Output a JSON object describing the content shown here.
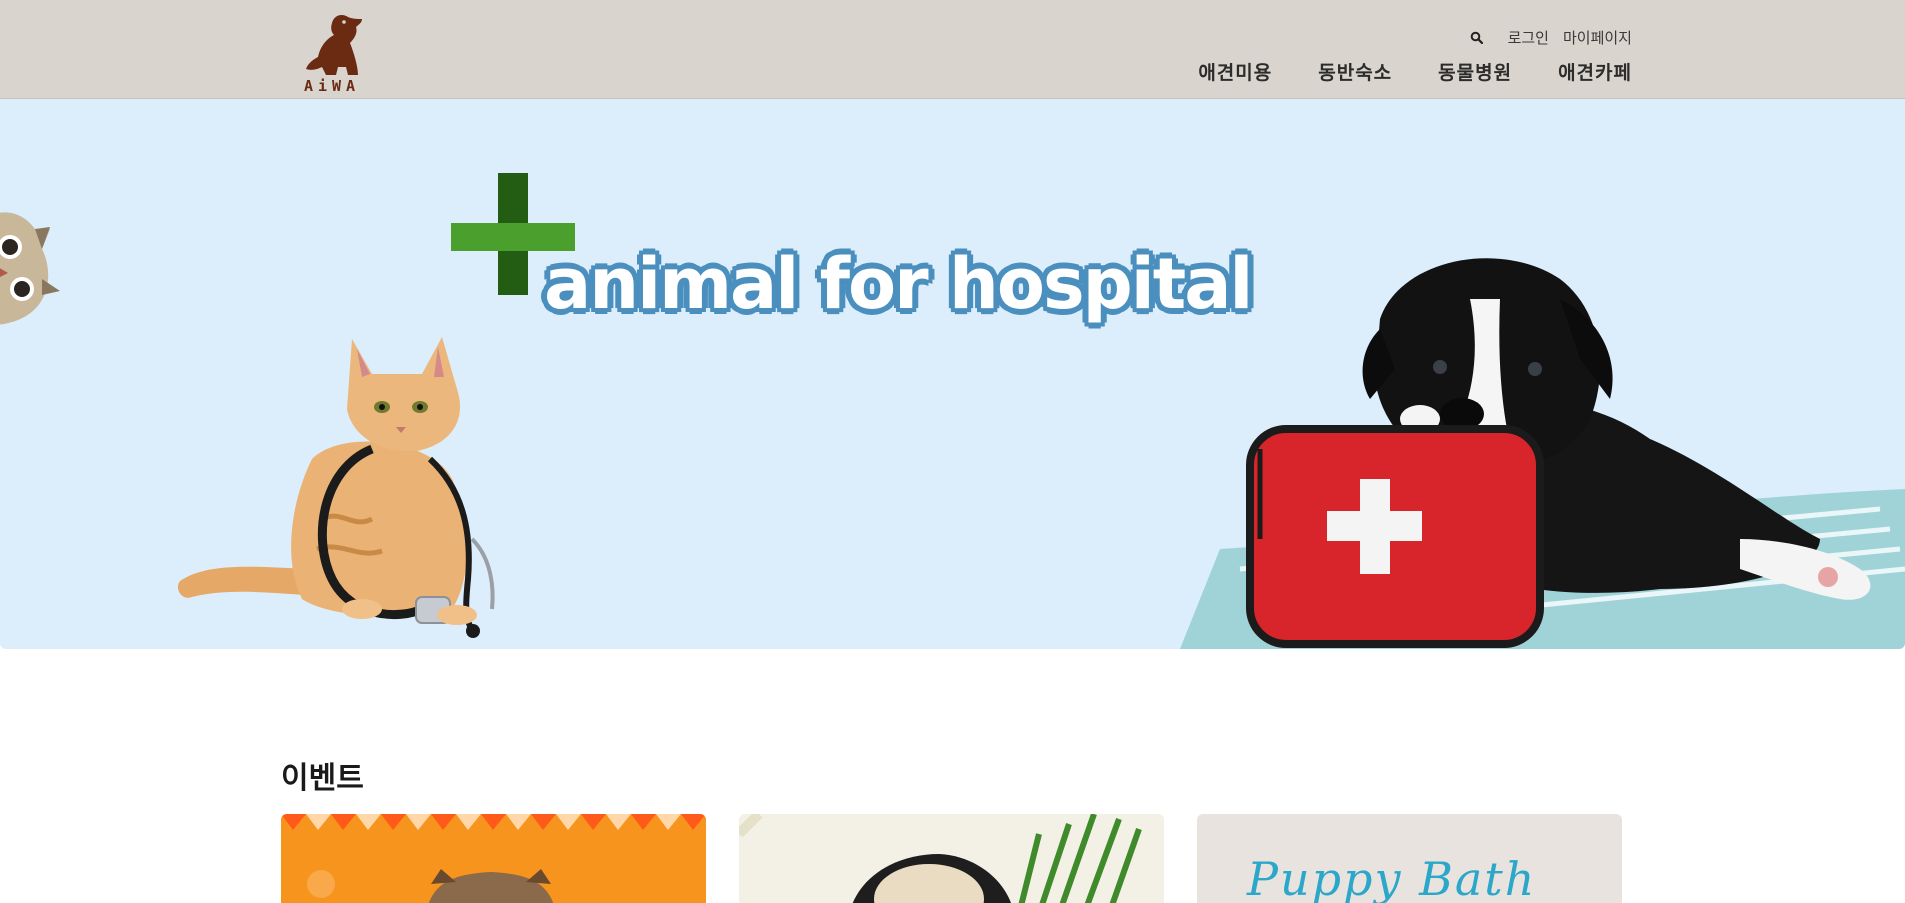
{
  "header": {
    "logo_text": "AiWA",
    "util": {
      "search_icon": "search-icon",
      "login": "로그인",
      "mypage": "마이페이지"
    },
    "nav": [
      "애견미용",
      "동반숙소",
      "동물병원",
      "애견카페"
    ]
  },
  "hero": {
    "title": "animal for hospital",
    "colors": {
      "background": "#dcedfb",
      "title_outline": "#4a8fbe",
      "cross_dark": "#235d14",
      "cross_light": "#4ba02d"
    }
  },
  "events": {
    "title": "이벤트",
    "cards": [
      {
        "name": "event-card-1",
        "caption": ""
      },
      {
        "name": "event-card-2",
        "caption": ""
      },
      {
        "name": "event-card-3",
        "caption": "Puppy Bath"
      }
    ]
  }
}
